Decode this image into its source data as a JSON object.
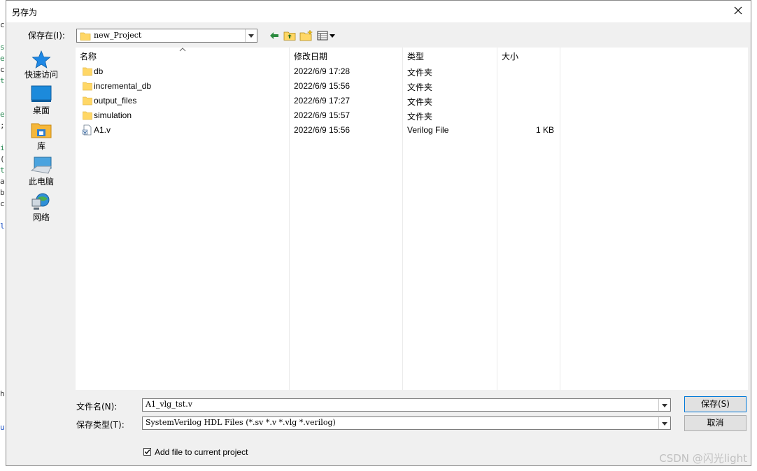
{
  "background_code": [
    "c",
    "s",
    "e",
    "c",
    "t",
    "e",
    ";",
    "i",
    "(",
    "t",
    "a",
    "b",
    "c",
    "l",
    "h",
    "u"
  ],
  "dialog": {
    "title": "另存为",
    "save_in_label": "保存在(I):",
    "save_in_value": "new_Project",
    "places": [
      {
        "label": "快速访问",
        "icon": "star-icon"
      },
      {
        "label": "桌面",
        "icon": "desktop-icon"
      },
      {
        "label": "库",
        "icon": "library-icon"
      },
      {
        "label": "此电脑",
        "icon": "computer-icon"
      },
      {
        "label": "网络",
        "icon": "network-icon"
      }
    ],
    "columns": {
      "name": "名称",
      "modified": "修改日期",
      "type": "类型",
      "size": "大小"
    },
    "files": [
      {
        "name": "db",
        "modified": "2022/6/9 17:28",
        "type": "文件夹",
        "size": "",
        "kind": "folder"
      },
      {
        "name": "incremental_db",
        "modified": "2022/6/9 15:56",
        "type": "文件夹",
        "size": "",
        "kind": "folder"
      },
      {
        "name": "output_files",
        "modified": "2022/6/9 17:27",
        "type": "文件夹",
        "size": "",
        "kind": "folder"
      },
      {
        "name": "simulation",
        "modified": "2022/6/9 15:57",
        "type": "文件夹",
        "size": "",
        "kind": "folder"
      },
      {
        "name": "A1.v",
        "modified": "2022/6/9 15:56",
        "type": "Verilog File",
        "size": "1 KB",
        "kind": "file"
      }
    ],
    "filename_label": "文件名(N):",
    "filename_value": "A1_vlg_tst.v",
    "filetype_label": "保存类型(T):",
    "filetype_value": "SystemVerilog HDL Files (*.sv *.v *.vlg *.verilog)",
    "save_button": "保存(S)",
    "cancel_button": "取消",
    "checkbox_label": "Add file to current project",
    "checkbox_checked": true
  },
  "watermark": "CSDN @闪光light"
}
